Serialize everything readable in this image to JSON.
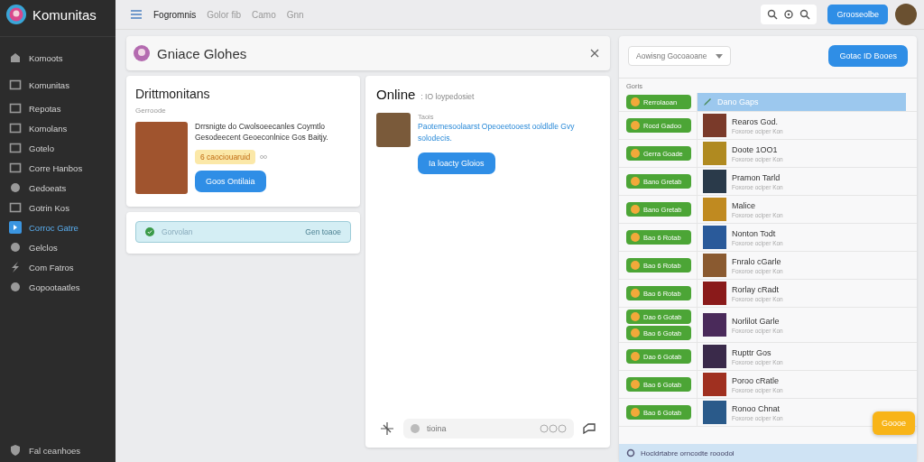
{
  "sidebar": {
    "brand": "Komunitas",
    "items": [
      {
        "label": "Komoots",
        "selected": false
      },
      {
        "label": "Komunitas",
        "selected": false
      },
      {
        "label": "Repotas",
        "selected": false
      },
      {
        "label": "Komolans",
        "selected": false
      },
      {
        "label": "Gotelo",
        "selected": false
      },
      {
        "label": "Corre Hanbos",
        "selected": false
      },
      {
        "label": "Gedoeats",
        "selected": false
      },
      {
        "label": "Gotrin Kos",
        "selected": false
      },
      {
        "label": "Corroc Gatre",
        "selected": true
      },
      {
        "label": "Gelclos",
        "selected": false
      },
      {
        "label": "Com Fatros",
        "selected": false
      },
      {
        "label": "Gopootaatles",
        "selected": false
      }
    ],
    "footer": "Fal ceanhoes"
  },
  "topbar": {
    "tabs": [
      {
        "label": "Fogromnis",
        "selected": true
      },
      {
        "label": "Golor fib",
        "selected": false
      },
      {
        "label": "Camo",
        "selected": false
      },
      {
        "label": "Gnn",
        "selected": false
      }
    ],
    "button": "Grooseolbe"
  },
  "header": {
    "title": "Gniace Glohes"
  },
  "profile_card": {
    "title": "Drittmonitans",
    "subtitle": "Gerroode",
    "description": "Drrsnigte do Cwolsoeecanles Coymtlo Gesodeecent Geoeconlnice Gos Baitjy.",
    "tag": "6 caociouaruid",
    "button": "Goos Ontilaia"
  },
  "notice": {
    "label": "Gorvolan",
    "action": "Gen toaoe"
  },
  "online": {
    "title": "Online",
    "subtitle": ": IO loypedosiet",
    "item_title": "Taois",
    "item_text": "Paotemesoolaarst Opeoeetooest ooldldle Gvy solodecis.",
    "button": "Ia loacty Gloios",
    "composer": {
      "placeholder": "tioina"
    }
  },
  "list_panel": {
    "dropdown": "Aowisng Gocoaoane",
    "button": "Gotac ID Booes",
    "label": "Goris",
    "rows": [
      {
        "buttons": [
          "Rerrolaoan"
        ],
        "title": "Dano Gaps",
        "selected": true
      },
      {
        "buttons": [
          "Rocd Gadoo"
        ],
        "title": "Rearos God.",
        "subtitle": "Foxoroe ociper Kon",
        "selected": false
      },
      {
        "buttons": [
          "Gerra Goade"
        ],
        "title": "Doote 1OO1",
        "subtitle": "Foxoroe ociper Kon",
        "selected": false
      },
      {
        "buttons": [
          "Bano Gretab"
        ],
        "title": "Pramon Tarld",
        "subtitle": "Foxoroe ociper Kon",
        "selected": false
      },
      {
        "buttons": [
          "Bano Gretab"
        ],
        "title": "Malice",
        "subtitle": "Foxoroe ociper Kon",
        "selected": false
      },
      {
        "buttons": [
          "Bao 6 Rotab"
        ],
        "title": "Nonton Todt",
        "subtitle": "Foxoroe ociper Kon",
        "selected": false
      },
      {
        "buttons": [
          "Bao 6 Rotab"
        ],
        "title": "Fnralo cGarle",
        "subtitle": "Foxoroe ociper Kon",
        "selected": false
      },
      {
        "buttons": [
          "Bao 6 Rotab"
        ],
        "title": "Rorlay cRadt",
        "subtitle": "Foxoroe ociper Kon",
        "selected": false
      },
      {
        "buttons": [
          "Dao 6 Gotab",
          "Bao 6 Gotab"
        ],
        "title": "Norlilot Garle",
        "subtitle": "Foxoroe ociper Kon",
        "selected": false
      },
      {
        "buttons": [
          "Dao 6 Gotab"
        ],
        "title": "Rupttr Gos",
        "subtitle": "Foxoroe ociper Kon",
        "selected": false
      },
      {
        "buttons": [
          "Bao 6 Gotab"
        ],
        "title": "Poroo cRatle",
        "subtitle": "Foxoroe ociper Kon",
        "selected": false
      },
      {
        "buttons": [
          "Bao 6 Gotab"
        ],
        "title": "Ronoo Chnat",
        "subtitle": "Foxoroe ociper Kon",
        "selected": false
      }
    ],
    "footer": "Hocldrtabre orncodte rooodol"
  },
  "fab": "Goooe"
}
